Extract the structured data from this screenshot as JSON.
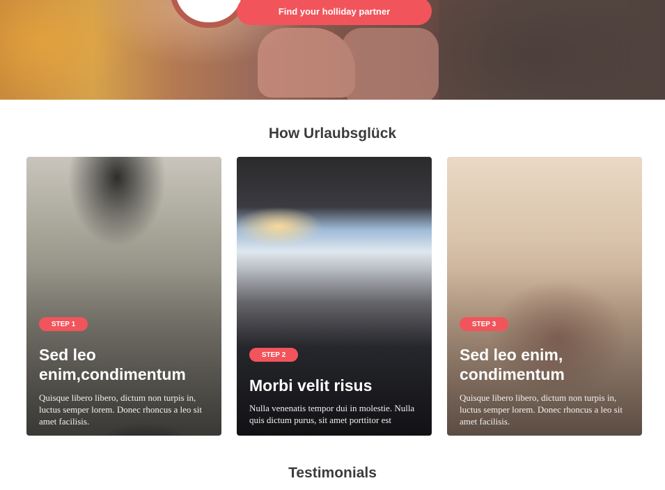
{
  "hero": {
    "cta_label": "Find your holliday partner"
  },
  "how": {
    "title": "How Urlaubsglück",
    "cards": [
      {
        "step": "STEP 1",
        "title": "Sed leo enim,condimentum",
        "text": "Quisque libero libero, dictum non turpis in, luctus semper lorem. Donec rhoncus a leo sit amet facilisis."
      },
      {
        "step": "STEP 2",
        "title": "Morbi velit risus",
        "text": "Nulla venenatis tempor dui in molestie. Nulla quis dictum purus, sit amet porttitor est"
      },
      {
        "step": "STEP 3",
        "title": "Sed leo enim, condimentum",
        "text": "Quisque libero libero, dictum non turpis in, luctus semper lorem. Donec rhoncus a leo sit amet facilisis."
      }
    ]
  },
  "testimonials": {
    "title": "Testimonials"
  },
  "colors": {
    "accent": "#f2545b",
    "heading": "#3b3b3b"
  }
}
